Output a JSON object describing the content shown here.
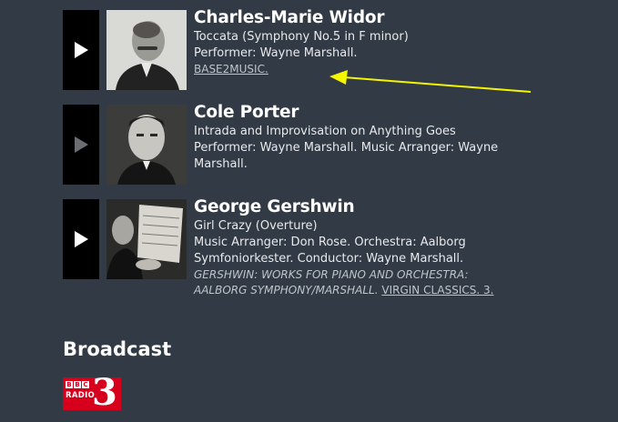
{
  "tracks": [
    {
      "composer": "Charles-Marie Widor",
      "title": "Toccata (Symphony No.5 in F minor)",
      "performer": "Performer: Wayne Marshall.",
      "label": "BASE2MUSIC.",
      "play_icon": "play-icon"
    },
    {
      "composer": "Cole Porter",
      "title": "Intrada and Improvisation on Anything Goes",
      "performer_line1": "Performer: Wayne Marshall. Music Arranger: Wayne",
      "performer_line2": "Marshall.",
      "play_icon": "play-icon"
    },
    {
      "composer": "George Gershwin",
      "title": "Girl Crazy (Overture)",
      "credits_line1": "Music Arranger: Don Rose. Orchestra: Aalborg",
      "credits_line2": "Symfoniorkester. Conductor: Wayne Marshall.",
      "album_line1": "GERSHWIN: WORKS FOR PIANO AND ORCHESTRA:",
      "album_line2": "AALBORG SYMPHONY/MARSHALL.",
      "label": "VIRGIN CLASSICS. 3.",
      "play_icon": "play-icon"
    }
  ],
  "broadcast": {
    "heading": "Broadcast",
    "logo": {
      "letters": [
        "B",
        "B",
        "C"
      ],
      "radio": "RADIO",
      "number": "3"
    }
  },
  "colors": {
    "background": "#323a45",
    "annotation_arrow": "#f5f500",
    "logo_red": "#d6001c"
  }
}
